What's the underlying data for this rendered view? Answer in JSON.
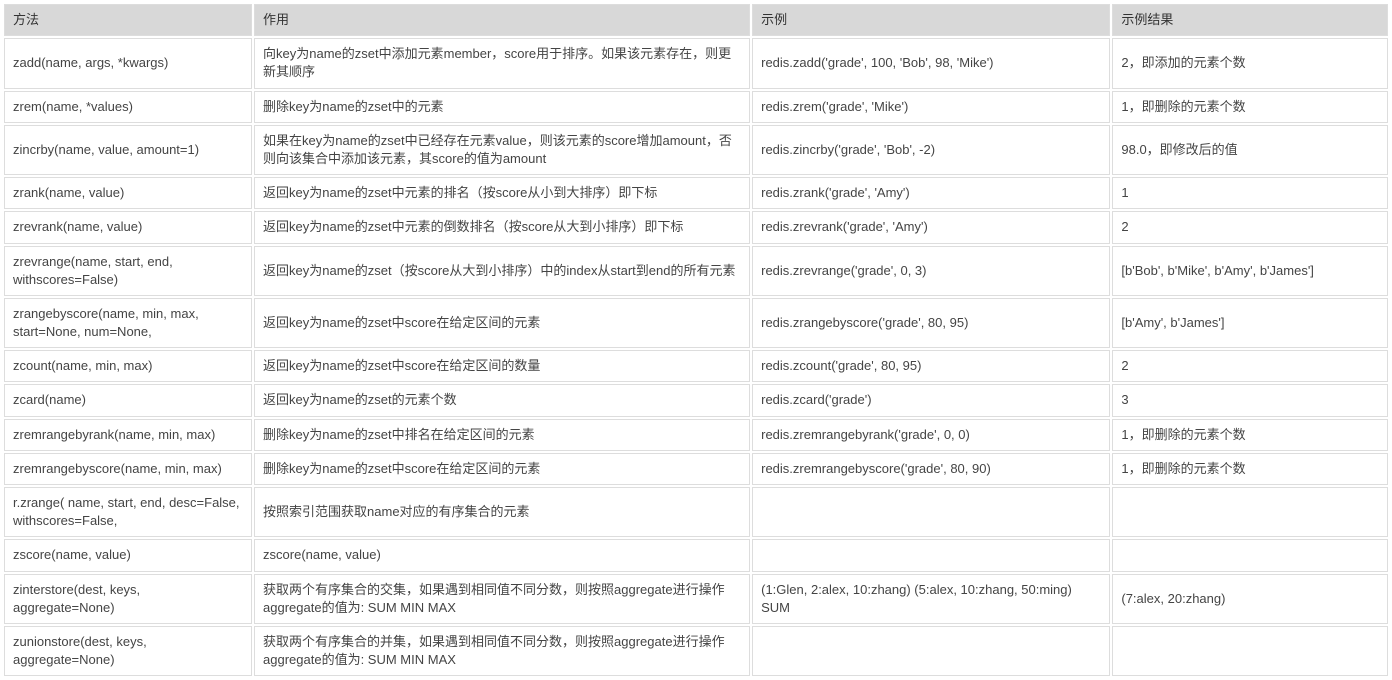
{
  "headers": [
    "方法",
    "作用",
    "示例",
    "示例结果"
  ],
  "rows": [
    {
      "method": "zadd(name, args, *kwargs)",
      "desc": "向key为name的zset中添加元素member，score用于排序。如果该元素存在，则更新其顺序",
      "example": "redis.zadd('grade', 100, 'Bob', 98, 'Mike')",
      "result": "2，即添加的元素个数"
    },
    {
      "method": "zrem(name, *values)",
      "desc": "删除key为name的zset中的元素",
      "example": "redis.zrem('grade', 'Mike')",
      "result": "1，即删除的元素个数"
    },
    {
      "method": "zincrby(name, value, amount=1)",
      "desc": "如果在key为name的zset中已经存在元素value，则该元素的score增加amount，否则向该集合中添加该元素，其score的值为amount",
      "example": "redis.zincrby('grade', 'Bob', -2)",
      "result": "98.0，即修改后的值"
    },
    {
      "method": "zrank(name, value)",
      "desc": "返回key为name的zset中元素的排名（按score从小到大排序）即下标",
      "example": "redis.zrank('grade', 'Amy')",
      "result": "1"
    },
    {
      "method": "zrevrank(name, value)",
      "desc": "返回key为name的zset中元素的倒数排名（按score从大到小排序）即下标",
      "example": "redis.zrevrank('grade', 'Amy')",
      "result": "2"
    },
    {
      "method": "zrevrange(name, start, end, withscores=False)",
      "desc": "返回key为name的zset（按score从大到小排序）中的index从start到end的所有元素",
      "example": "redis.zrevrange('grade', 0, 3)",
      "result": "[b'Bob', b'Mike', b'Amy', b'James']"
    },
    {
      "method": "zrangebyscore(name, min, max, start=None, num=None,",
      "desc": "返回key为name的zset中score在给定区间的元素",
      "example": "redis.zrangebyscore('grade', 80, 95)",
      "result": "[b'Amy', b'James']"
    },
    {
      "method": "zcount(name, min, max)",
      "desc": "返回key为name的zset中score在给定区间的数量",
      "example": "redis.zcount('grade', 80, 95)",
      "result": "2"
    },
    {
      "method": "zcard(name)",
      "desc": "返回key为name的zset的元素个数",
      "example": "redis.zcard('grade')",
      "result": "3"
    },
    {
      "method": "zremrangebyrank(name, min, max)",
      "desc": "删除key为name的zset中排名在给定区间的元素",
      "example": "redis.zremrangebyrank('grade', 0, 0)",
      "result": "1，即删除的元素个数"
    },
    {
      "method": "zremrangebyscore(name, min, max)",
      "desc": "删除key为name的zset中score在给定区间的元素",
      "example": "redis.zremrangebyscore('grade', 80, 90)",
      "result": "1，即删除的元素个数"
    },
    {
      "method": "r.zrange( name, start, end, desc=False, withscores=False,",
      "desc": "按照索引范围获取name对应的有序集合的元素",
      "example": "",
      "result": ""
    },
    {
      "method": "zscore(name, value)",
      "desc": "zscore(name, value)",
      "example": "",
      "result": ""
    },
    {
      "method": "zinterstore(dest, keys, aggregate=None)",
      "desc": "获取两个有序集合的交集，如果遇到相同值不同分数，则按照aggregate进行操作 aggregate的值为:  SUM  MIN  MAX",
      "example": "(1:Glen, 2:alex, 10:zhang) (5:alex, 10:zhang, 50:ming) SUM",
      "result": "(7:alex, 20:zhang)"
    },
    {
      "method": "zunionstore(dest, keys, aggregate=None)",
      "desc": "获取两个有序集合的并集，如果遇到相同值不同分数，则按照aggregate进行操作 aggregate的值为:  SUM  MIN  MAX",
      "example": "",
      "result": ""
    }
  ]
}
